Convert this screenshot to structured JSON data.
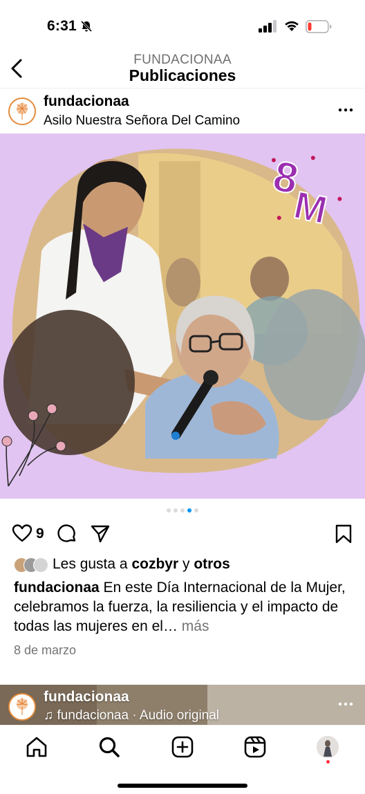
{
  "status_bar": {
    "time": "6:31",
    "icons": [
      "mute-bell-icon",
      "signal-icon",
      "wifi-icon",
      "battery-low-icon"
    ],
    "battery_color": "#ff3b30"
  },
  "header": {
    "subtitle": "FUNDACIONAA",
    "title": "Publicaciones"
  },
  "post": {
    "username": "fundacionaa",
    "location": "Asilo Nuestra Señora Del Camino",
    "image_badge": "8M",
    "carousel": {
      "total": 5,
      "active_index": 3
    },
    "like_count": "9",
    "likes_prefix": "Les gusta a",
    "likes_user": "cozbyr",
    "likes_connector": "y",
    "likes_others": "otros",
    "caption_user": "fundacionaa",
    "caption_text": "En este Día Internacional de la Mujer, celebramos la fuerza, la resiliencia y el impacto de todas las mujeres en el…",
    "caption_more": "más",
    "date": "8 de marzo",
    "colors": {
      "image_bg": "#e1c4f1",
      "badge": "#9b2fb0",
      "link_blue": "#0095f6"
    }
  },
  "next_post": {
    "username": "fundacionaa",
    "audio": "♫ fundacionaa · Audio original"
  },
  "tab_bar": {
    "tabs": [
      "home-icon",
      "search-icon",
      "create-icon",
      "reels-icon",
      "profile-avatar"
    ]
  }
}
